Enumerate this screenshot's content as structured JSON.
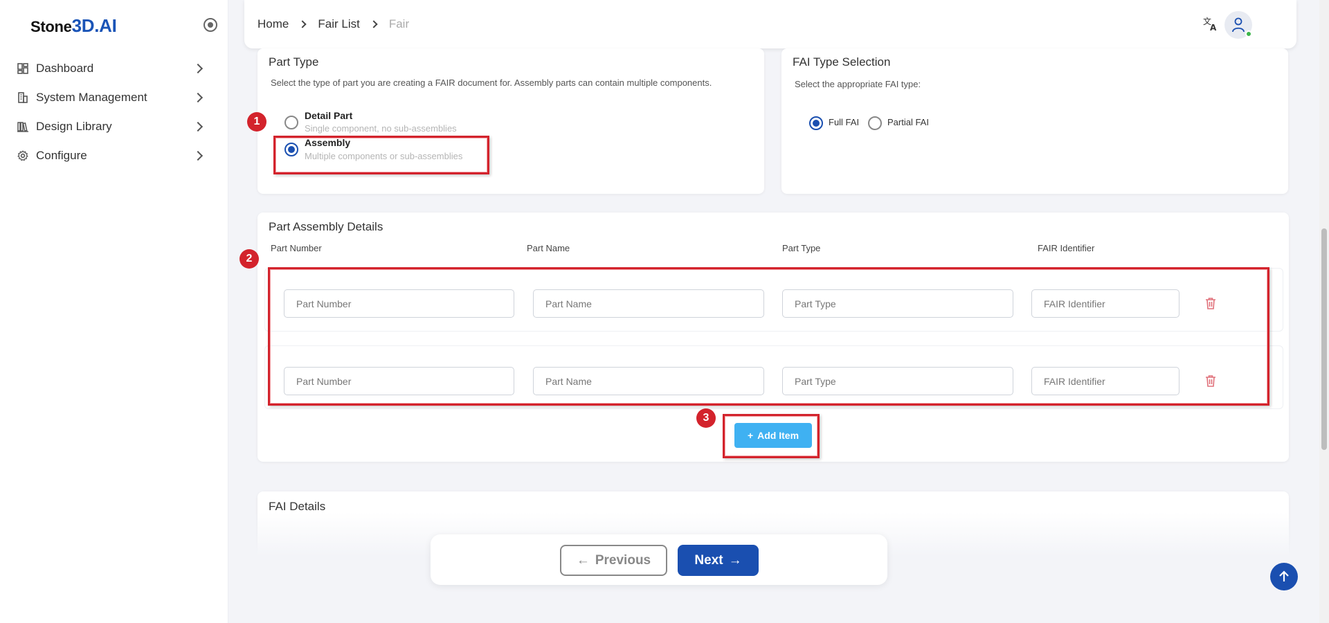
{
  "sidebar": {
    "logo_prefix": "Stone",
    "logo_accent": "3D.AI",
    "items": [
      {
        "label": "Dashboard",
        "icon": "dashboard-icon"
      },
      {
        "label": "System Management",
        "icon": "building-icon"
      },
      {
        "label": "Design Library",
        "icon": "library-icon"
      },
      {
        "label": "Configure",
        "icon": "gear-icon"
      }
    ]
  },
  "header": {
    "breadcrumb": [
      "Home",
      "Fair List",
      "Fair"
    ]
  },
  "part_type": {
    "title": "Part Type",
    "description": "Select the type of part you are creating a FAIR document for. Assembly parts can contain multiple components.",
    "options": [
      {
        "label": "Detail Part",
        "sub": "Single component, no sub-assemblies",
        "checked": false
      },
      {
        "label": "Assembly",
        "sub": "Multiple components or sub-assemblies",
        "checked": true
      }
    ]
  },
  "fai_type": {
    "title": "FAI Type Selection",
    "description": "Select the appropriate FAI type:",
    "options": [
      {
        "label": "Full FAI",
        "checked": true
      },
      {
        "label": "Partial FAI",
        "checked": false
      }
    ]
  },
  "assembly": {
    "title": "Part Assembly Details",
    "columns": [
      "Part Number",
      "Part Name",
      "Part Type",
      "FAIR Identifier"
    ],
    "placeholders": {
      "part_number": "Part Number",
      "part_name": "Part Name",
      "part_type": "Part Type",
      "fair_identifier": "FAIR Identifier"
    },
    "add_item_label": "Add Item"
  },
  "fai_details": {
    "title": "FAI Details"
  },
  "footer": {
    "previous_label": "Previous",
    "next_label": "Next"
  },
  "markers": [
    "1",
    "2",
    "3"
  ],
  "colors": {
    "primary": "#1a4fb0",
    "accent_button": "#3fb1f2",
    "highlight": "#d3232c",
    "delete": "#e0707a"
  }
}
